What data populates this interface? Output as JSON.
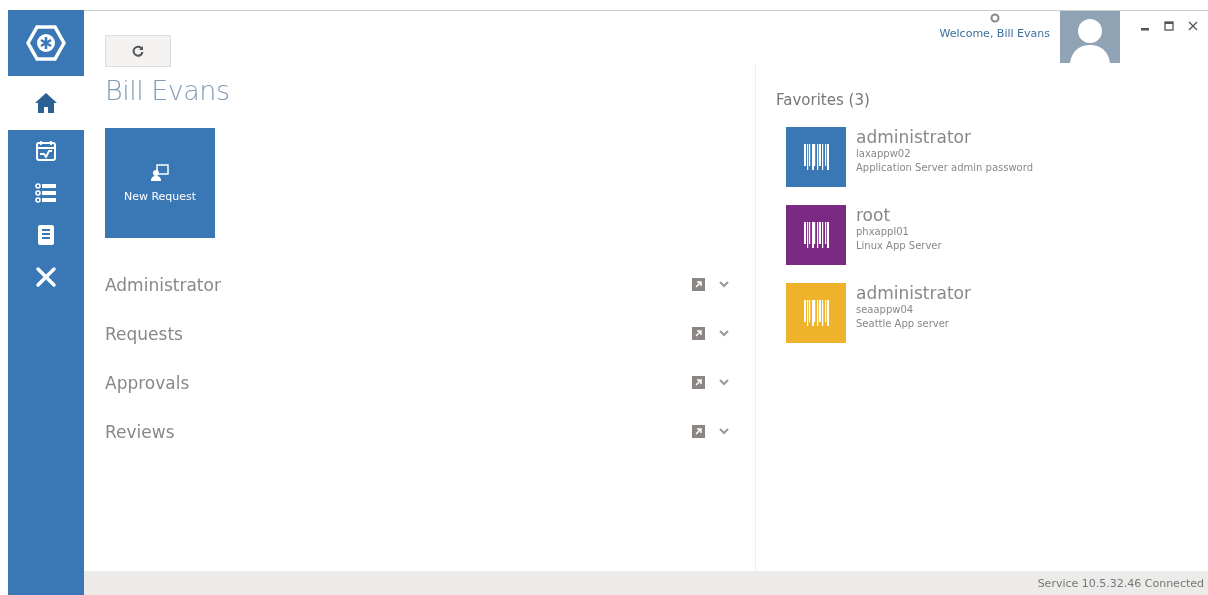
{
  "sidebar": {
    "items": [
      {
        "selected": true
      },
      {
        "selected": false
      },
      {
        "selected": false
      },
      {
        "selected": false
      },
      {
        "selected": false
      }
    ]
  },
  "header": {
    "welcome": "Welcome, Bill Evans"
  },
  "title": "Bill Evans",
  "tile": {
    "label": "New Request"
  },
  "sections": [
    {
      "label": "Administrator"
    },
    {
      "label": "Requests"
    },
    {
      "label": "Approvals"
    },
    {
      "label": "Reviews"
    }
  ],
  "favorites": {
    "title": "Favorites (3)",
    "items": [
      {
        "name": "administrator",
        "host": "laxappw02",
        "description": "Application Server admin password",
        "color": "#3a78b5"
      },
      {
        "name": "root",
        "host": "phxappl01",
        "description": "Linux App Server",
        "color": "#7b2a83"
      },
      {
        "name": "administrator",
        "host": "seaappw04",
        "description": "Seattle App server",
        "color": "#efb32b"
      }
    ]
  },
  "status_bar": "Service 10.5.32.46 Connected"
}
